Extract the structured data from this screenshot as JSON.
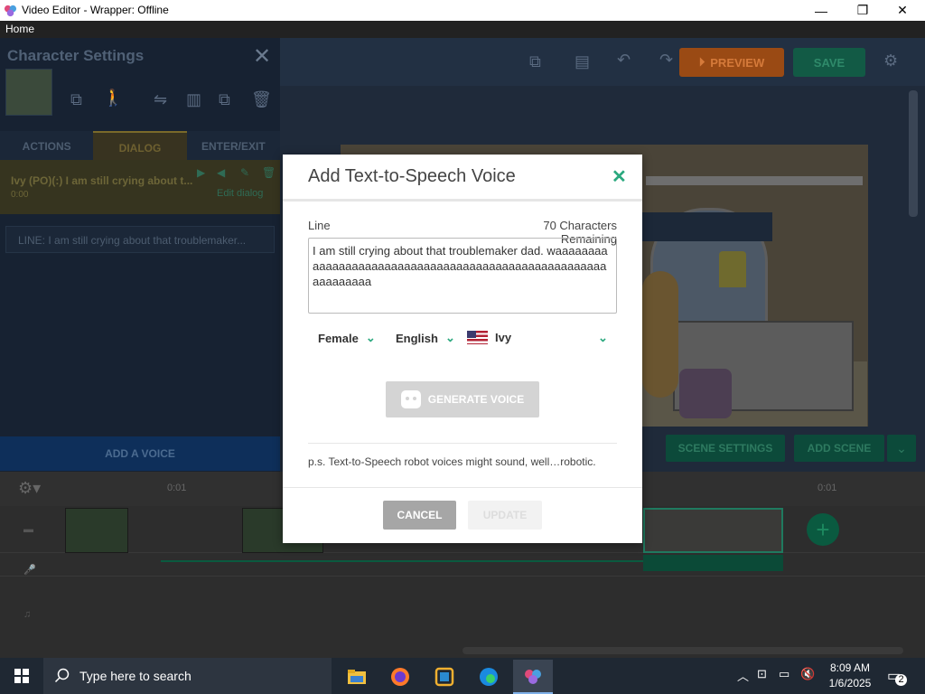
{
  "window": {
    "title": "Video Editor - Wrapper: Offline",
    "minimize": "—",
    "maximize": "❐",
    "close": "✕"
  },
  "menu": {
    "home": "Home"
  },
  "toolbar": {
    "preview_label": "PREVIEW",
    "save_label": "SAVE"
  },
  "left_panel": {
    "title": "Character Settings",
    "close": "✕",
    "tabs": [
      "ACTIONS",
      "DIALOG",
      "ENTER/EXIT"
    ],
    "active_tab": "DIALOG",
    "dialog_line": "Ivy (PO)(:) I am still crying about t...",
    "dialog_time": "0:00",
    "dialog_edit": "Edit dialog",
    "line_preview": "LINE: I am still crying about that troublemaker...",
    "add_voice": "ADD A VOICE"
  },
  "stage_buttons": {
    "scene_settings": "SCENE SETTINGS",
    "add_scene": "ADD SCENE",
    "add_scene_dropdown": "⌄"
  },
  "timeline": {
    "time_start": "0:01",
    "time_end": "0:01",
    "add_button": "+"
  },
  "modal": {
    "title": "Add Text-to-Speech Voice",
    "close": "✕",
    "line_label": "Line",
    "remaining": "70 Characters Remaining",
    "text_value": "I am still crying about that troublemaker dad. waaaaaaaaaaaaaaaaaaaaaaaaaaaaaaaaaaaaaaaaaaaaaaaaaaaaaaaaaaaaaa",
    "gender": "Female",
    "language": "English",
    "voice": "Ivy",
    "generate_label": "GENERATE VOICE",
    "note": "p.s. Text-to-Speech robot voices might sound, well…robotic.",
    "cancel_label": "CANCEL",
    "update_label": "UPDATE"
  },
  "taskbar": {
    "search_placeholder": "Type here to search",
    "time": "8:09 AM",
    "date": "1/6/2025",
    "notifications": "2"
  },
  "colors": {
    "accent_green": "#2aa87e",
    "preview_orange": "#9a4a14",
    "taskbar": "#1f2833"
  }
}
